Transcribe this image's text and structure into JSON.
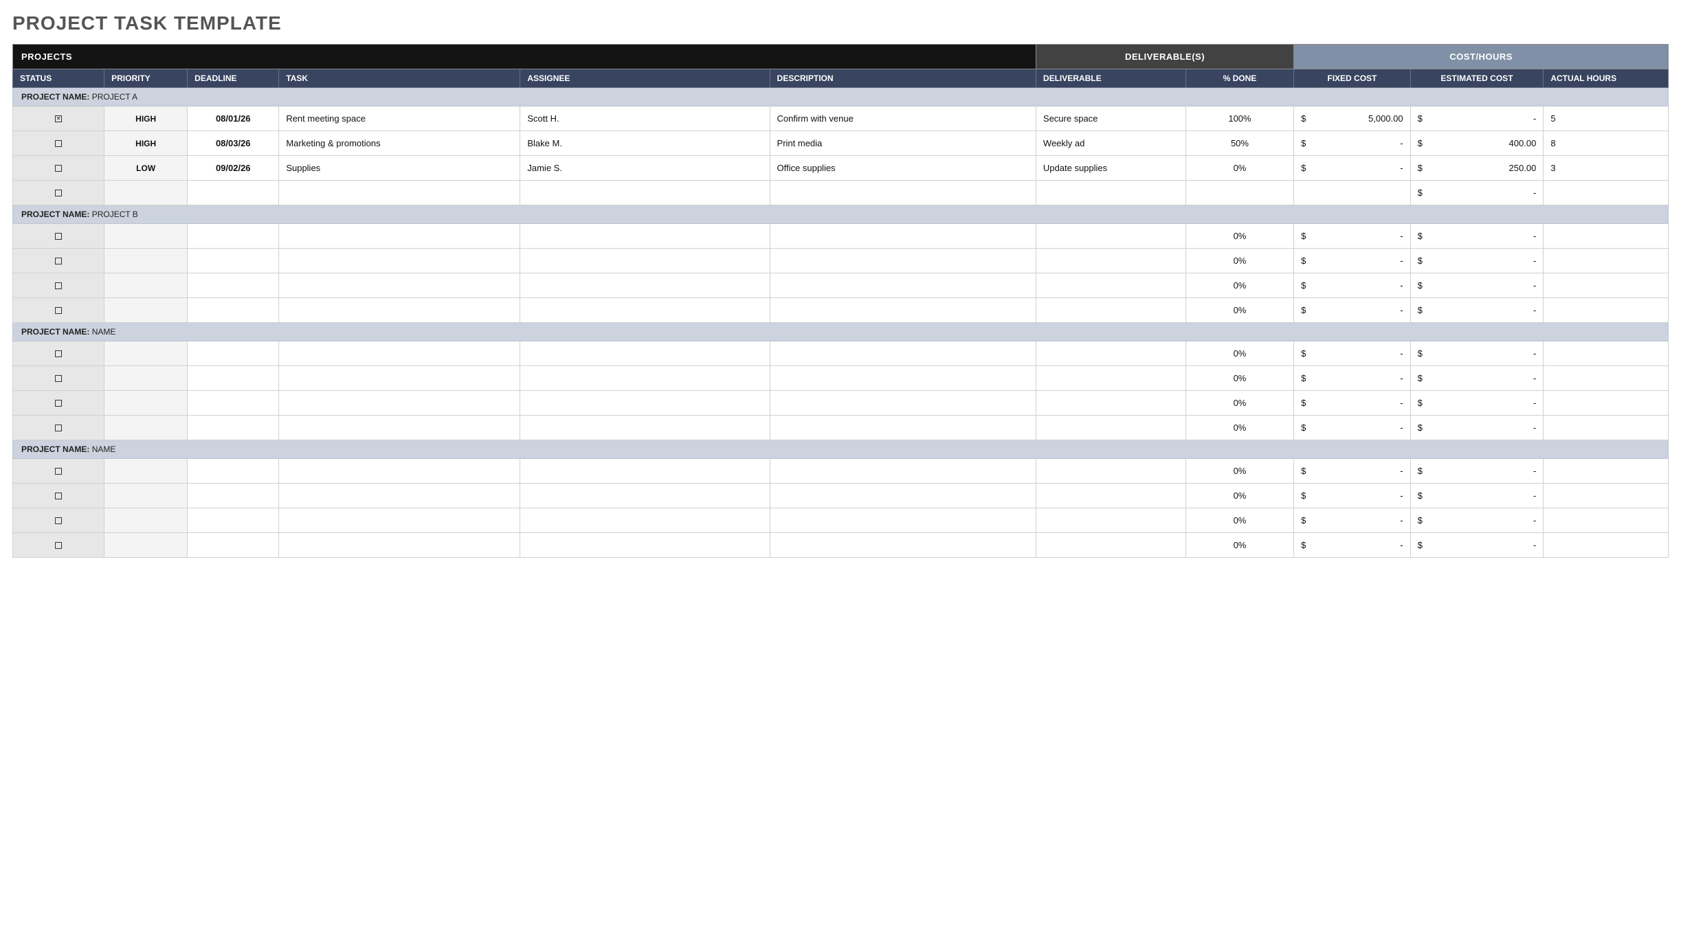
{
  "title": "PROJECT TASK TEMPLATE",
  "super_headers": {
    "projects": "PROJECTS",
    "deliverables": "DELIVERABLE(S)",
    "cost_hours": "COST/HOURS"
  },
  "columns": {
    "status": "STATUS",
    "priority": "PRIORITY",
    "deadline": "DEADLINE",
    "task": "TASK",
    "assignee": "ASSIGNEE",
    "description": "DESCRIPTION",
    "deliverable": "DELIVERABLE",
    "pct_done": "% DONE",
    "fixed_cost": "FIXED COST",
    "est_cost": "ESTIMATED COST",
    "actual_hours": "ACTUAL HOURS"
  },
  "section_label": "PROJECT NAME:",
  "currency_symbol": "$",
  "dash": "-",
  "sections": [
    {
      "name": "PROJECT A",
      "rows": [
        {
          "checked": true,
          "priority": "HIGH",
          "deadline": "08/01/26",
          "task": "Rent meeting space",
          "assignee": "Scott H.",
          "description": "Confirm with venue",
          "deliverable": "Secure space",
          "pct_done": "100%",
          "fixed_cost": "5,000.00",
          "est_cost": "-",
          "hours": "5"
        },
        {
          "checked": false,
          "priority": "HIGH",
          "deadline": "08/03/26",
          "task": "Marketing & promotions",
          "assignee": "Blake M.",
          "description": "Print media",
          "deliverable": "Weekly ad",
          "pct_done": "50%",
          "fixed_cost": "-",
          "est_cost": "400.00",
          "hours": "8"
        },
        {
          "checked": false,
          "priority": "LOW",
          "deadline": "09/02/26",
          "task": "Supplies",
          "assignee": "Jamie S.",
          "description": "Office supplies",
          "deliverable": "Update supplies",
          "pct_done": "0%",
          "fixed_cost": "-",
          "est_cost": "250.00",
          "hours": "3"
        },
        {
          "checked": false,
          "priority": "",
          "deadline": "",
          "task": "",
          "assignee": "",
          "description": "",
          "deliverable": "",
          "pct_done": "",
          "fixed_cost": "",
          "est_cost": "-",
          "hours": ""
        }
      ]
    },
    {
      "name": "PROJECT B",
      "rows": [
        {
          "checked": false,
          "priority": "",
          "deadline": "",
          "task": "",
          "assignee": "",
          "description": "",
          "deliverable": "",
          "pct_done": "0%",
          "fixed_cost": "-",
          "est_cost": "-",
          "hours": ""
        },
        {
          "checked": false,
          "priority": "",
          "deadline": "",
          "task": "",
          "assignee": "",
          "description": "",
          "deliverable": "",
          "pct_done": "0%",
          "fixed_cost": "-",
          "est_cost": "-",
          "hours": ""
        },
        {
          "checked": false,
          "priority": "",
          "deadline": "",
          "task": "",
          "assignee": "",
          "description": "",
          "deliverable": "",
          "pct_done": "0%",
          "fixed_cost": "-",
          "est_cost": "-",
          "hours": ""
        },
        {
          "checked": false,
          "priority": "",
          "deadline": "",
          "task": "",
          "assignee": "",
          "description": "",
          "deliverable": "",
          "pct_done": "0%",
          "fixed_cost": "-",
          "est_cost": "-",
          "hours": ""
        }
      ]
    },
    {
      "name": "NAME",
      "rows": [
        {
          "checked": false,
          "priority": "",
          "deadline": "",
          "task": "",
          "assignee": "",
          "description": "",
          "deliverable": "",
          "pct_done": "0%",
          "fixed_cost": "-",
          "est_cost": "-",
          "hours": ""
        },
        {
          "checked": false,
          "priority": "",
          "deadline": "",
          "task": "",
          "assignee": "",
          "description": "",
          "deliverable": "",
          "pct_done": "0%",
          "fixed_cost": "-",
          "est_cost": "-",
          "hours": ""
        },
        {
          "checked": false,
          "priority": "",
          "deadline": "",
          "task": "",
          "assignee": "",
          "description": "",
          "deliverable": "",
          "pct_done": "0%",
          "fixed_cost": "-",
          "est_cost": "-",
          "hours": ""
        },
        {
          "checked": false,
          "priority": "",
          "deadline": "",
          "task": "",
          "assignee": "",
          "description": "",
          "deliverable": "",
          "pct_done": "0%",
          "fixed_cost": "-",
          "est_cost": "-",
          "hours": ""
        }
      ]
    },
    {
      "name": "NAME",
      "rows": [
        {
          "checked": false,
          "priority": "",
          "deadline": "",
          "task": "",
          "assignee": "",
          "description": "",
          "deliverable": "",
          "pct_done": "0%",
          "fixed_cost": "-",
          "est_cost": "-",
          "hours": ""
        },
        {
          "checked": false,
          "priority": "",
          "deadline": "",
          "task": "",
          "assignee": "",
          "description": "",
          "deliverable": "",
          "pct_done": "0%",
          "fixed_cost": "-",
          "est_cost": "-",
          "hours": ""
        },
        {
          "checked": false,
          "priority": "",
          "deadline": "",
          "task": "",
          "assignee": "",
          "description": "",
          "deliverable": "",
          "pct_done": "0%",
          "fixed_cost": "-",
          "est_cost": "-",
          "hours": ""
        },
        {
          "checked": false,
          "priority": "",
          "deadline": "",
          "task": "",
          "assignee": "",
          "description": "",
          "deliverable": "",
          "pct_done": "0%",
          "fixed_cost": "-",
          "est_cost": "-",
          "hours": ""
        }
      ]
    }
  ]
}
